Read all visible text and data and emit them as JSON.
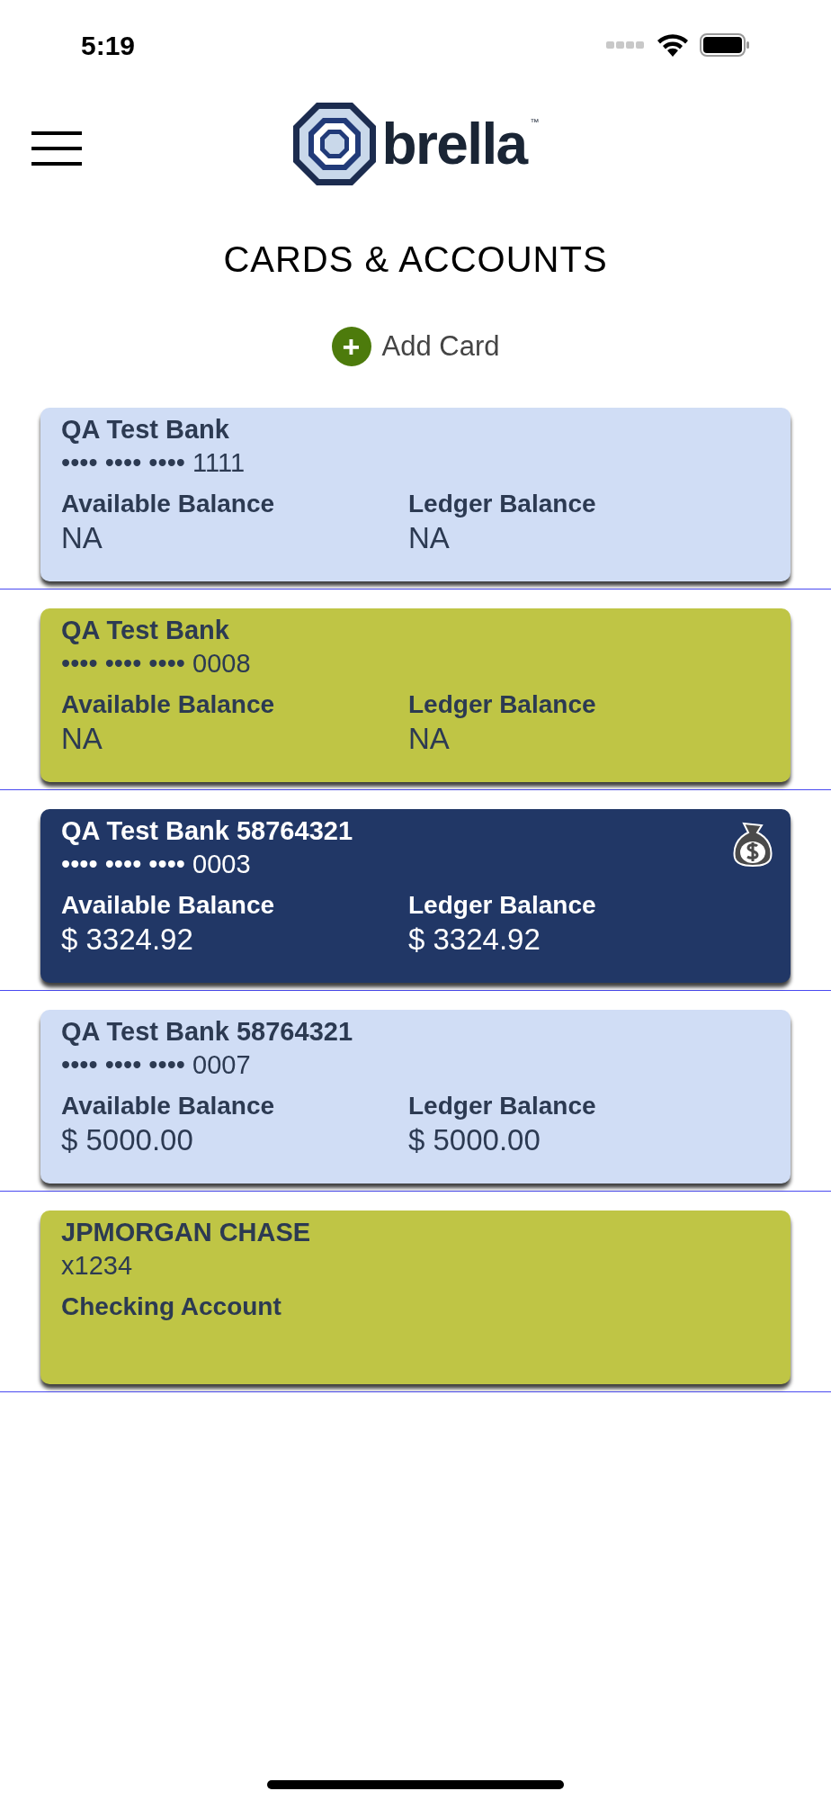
{
  "status_bar": {
    "time": "5:19"
  },
  "header": {
    "logo_text": "brella",
    "logo_mark": "™"
  },
  "title": "CARDS & ACCOUNTS",
  "add_button": {
    "icon": "+",
    "label": "Add Card"
  },
  "cards": [
    {
      "kind": "card",
      "color": "#d0ddf5",
      "dark": false,
      "funds_icon": false,
      "name": "QA Test Bank",
      "number": "•••• •••• •••• 1111",
      "available_label": "Available Balance",
      "available": "NA",
      "ledger_label": "Ledger Balance",
      "ledger": "NA"
    },
    {
      "kind": "card",
      "color": "#bfc545",
      "dark": false,
      "funds_icon": false,
      "name": "QA Test Bank",
      "number": "•••• •••• •••• 0008",
      "available_label": "Available Balance",
      "available": "NA",
      "ledger_label": "Ledger Balance",
      "ledger": "NA"
    },
    {
      "kind": "card",
      "color": "#213766",
      "dark": true,
      "funds_icon": true,
      "name": "QA Test Bank 58764321",
      "number": "•••• •••• •••• 0003",
      "available_label": "Available Balance",
      "available": "$ 3324.92",
      "ledger_label": "Ledger Balance",
      "ledger": "$ 3324.92"
    },
    {
      "kind": "card",
      "color": "#d0ddf5",
      "dark": false,
      "funds_icon": false,
      "name": "QA Test Bank 58764321",
      "number": "•••• •••• •••• 0007",
      "available_label": "Available Balance",
      "available": "$ 5000.00",
      "ledger_label": "Ledger Balance",
      "ledger": "$ 5000.00"
    },
    {
      "kind": "account",
      "color": "#bfc545",
      "dark": false,
      "funds_icon": false,
      "name": "JPMORGAN CHASE",
      "number": "x1234",
      "account_type": "Checking Account"
    }
  ]
}
